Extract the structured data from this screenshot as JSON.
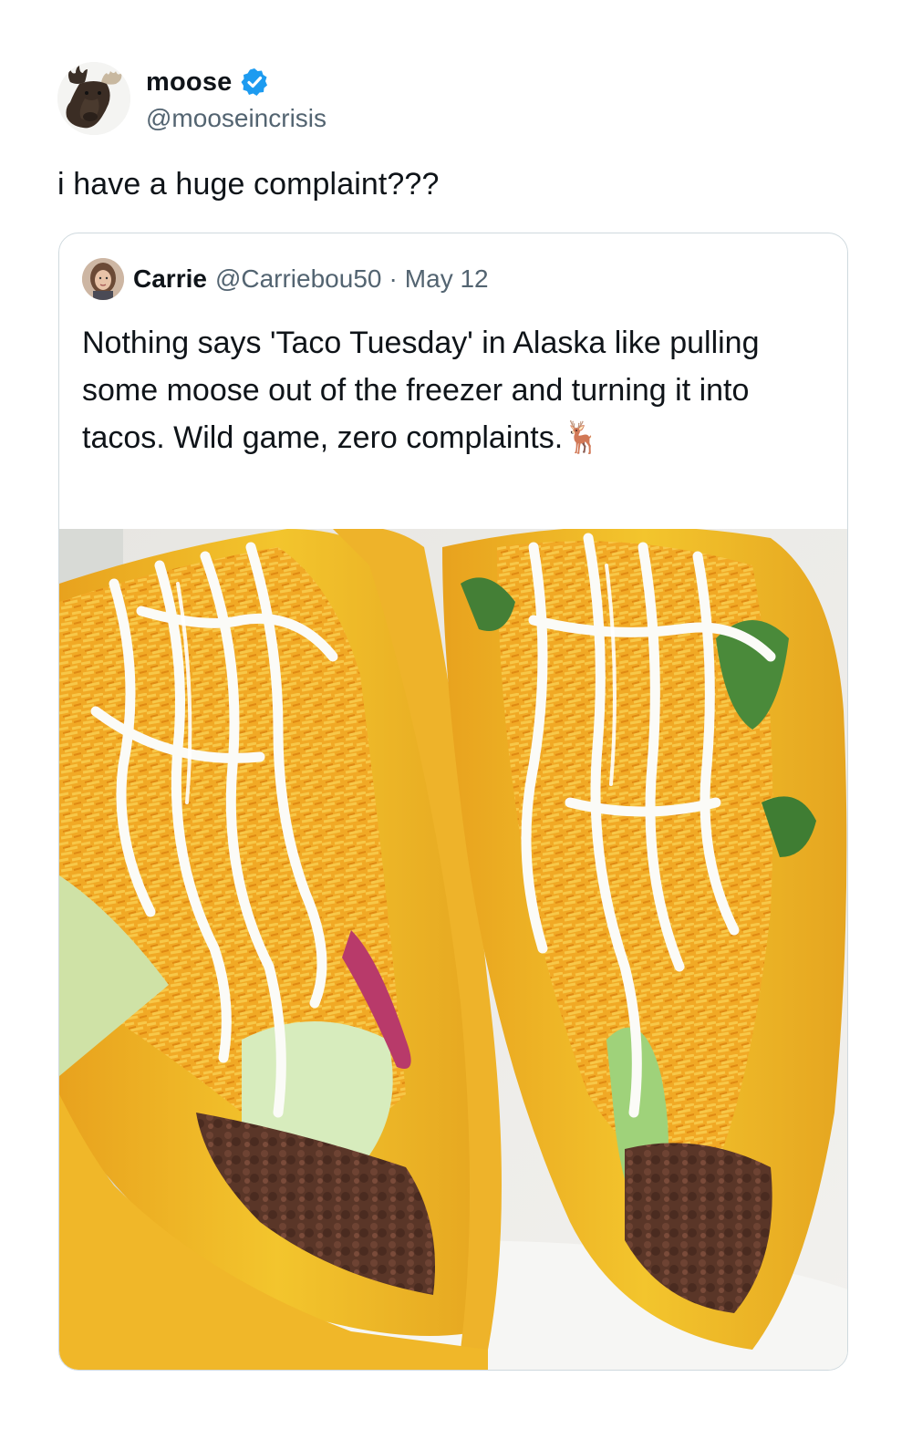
{
  "author": {
    "display_name": "moose",
    "handle": "@mooseincrisis",
    "verified": true,
    "avatar": "moose-avatar"
  },
  "tweet": {
    "text": "i have a huge complaint???"
  },
  "quoted": {
    "display_name": "Carrie",
    "handle": "@Carriebou50",
    "separator": "·",
    "date": "May 12",
    "text": "Nothing says 'Taco Tuesday' in Alaska like pulling some moose out of the freezer and turning it into tacos. Wild game, zero complaints.🦌",
    "image": "taco-photo"
  },
  "colors": {
    "verified_badge": "#1d9bf0",
    "secondary_text": "#536471",
    "primary_text": "#0f1419",
    "border": "#cfd9de"
  }
}
